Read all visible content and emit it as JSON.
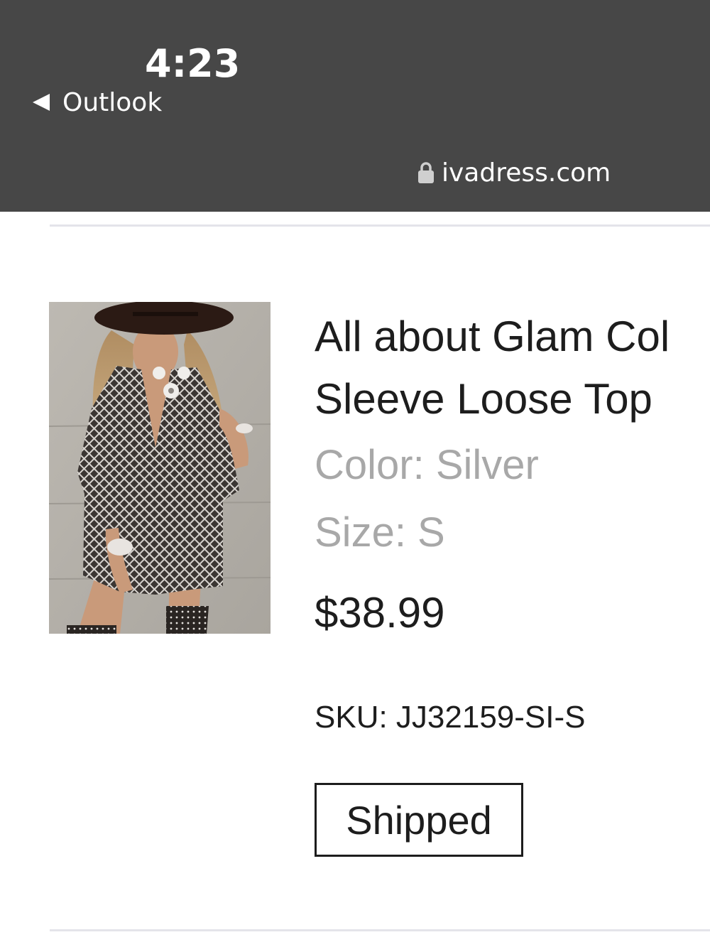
{
  "status_bar": {
    "time": "4:23",
    "back_app": "Outlook",
    "url": "ivadress.com"
  },
  "icons": {
    "back": "back-triangle-icon",
    "lock": "lock-icon"
  },
  "product": {
    "title_line1": "All about Glam Col",
    "title_line2": "Sleeve Loose Top",
    "color": "Color: Silver",
    "size": "Size: S",
    "price": "$38.99",
    "sku": "SKU: JJ32159-SI-S",
    "status": "Shipped"
  },
  "colors": {
    "status_bar_bg": "#474747",
    "text_primary": "#1d1d1d",
    "text_muted": "#a8a8a8",
    "divider": "#e4e4ea"
  }
}
